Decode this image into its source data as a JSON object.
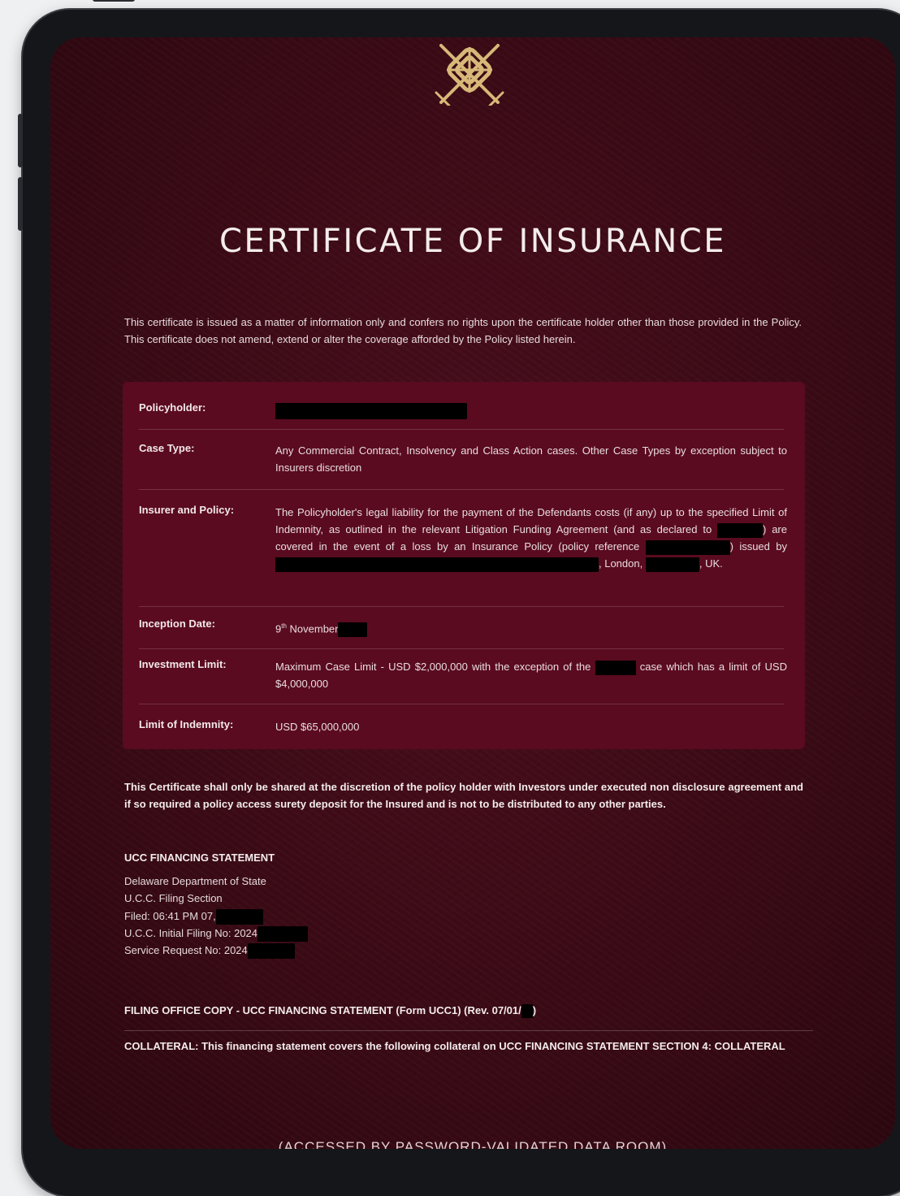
{
  "document": {
    "title": "CERTIFICATE OF INSURANCE",
    "intro": "This certificate is issued as a matter of information only and confers no rights upon the certificate holder other than those provided in the Policy. This certificate does not amend, extend or alter the coverage afforded by the Policy listed herein.",
    "rows": [
      {
        "label": "Policyholder:"
      },
      {
        "label": "Case Type:",
        "value": "Any Commercial Contract, Insolvency and Class Action cases. Other Case Types by exception subject to Insurers discretion"
      },
      {
        "label": "Insurer and Policy:",
        "p1": "The Policyholder's legal liability for the payment of the Defendants costs (if any) up to the specified Limit of Indemnity, as outlined in the relevant Litigation Funding Agreement (and as declared to",
        "p2": ") are covered in the event of a loss by an Insurance Policy (policy reference",
        "p3": ") issued by",
        "p4": ", London,",
        "p5": ", UK."
      },
      {
        "label": "Inception Date:",
        "day": "9",
        "sup": "th",
        "month": " November"
      },
      {
        "label": "Investment Limit:",
        "p1": "Maximum Case Limit - USD $2,000,000 with the exception of the",
        "p2": "case which has a limit of USD $4,000,000"
      },
      {
        "label": "Limit of Indemnity:",
        "value": "USD $65,000,000"
      }
    ],
    "notice": "This Certificate shall only be shared at the discretion of the policy holder with Investors under executed non disclosure agreement and if so required a policy access surety deposit for the Insured and is not to be distributed to any other parties.",
    "ucc": {
      "heading": "UCC FINANCING STATEMENT",
      "dept": "Delaware Department of State",
      "section": "U.C.C. Filing Section",
      "filed": "Filed: 06:41 PM 07,",
      "initial": "U.C.C. Initial Filing No: 2024",
      "service": "Service Request No: 2024"
    },
    "filing_copy": "FILING OFFICE COPY - UCC FINANCING STATEMENT (Form UCC1) (Rev. 07/01/",
    "filing_copy_end": ")",
    "collateral": "COLLATERAL: This financing statement covers the following collateral on UCC FINANCING STATEMENT SECTION 4: COLLATERAL",
    "accessed": "(ACCESSED BY PASSWORD-VALIDATED DATA ROOM)"
  },
  "colors": {
    "background": "#3a0a15",
    "panel": "#5a0b1f",
    "emblem": "#d8b878"
  },
  "icons": {
    "emblem": "celtic-knot-crossed-swords-icon"
  }
}
